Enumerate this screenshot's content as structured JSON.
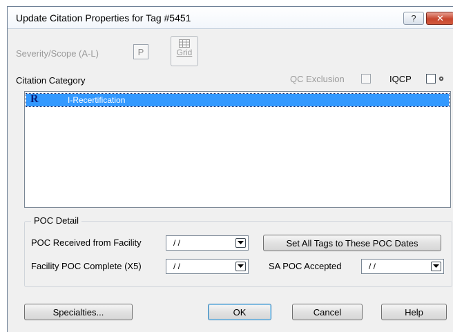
{
  "window": {
    "title": "Update Citation Properties for Tag #5451",
    "help_label": "?",
    "close_label": "✕"
  },
  "severity": {
    "label": "Severity/Scope (A-L)",
    "value": "P"
  },
  "grid_button": {
    "label": "Grid",
    "icon": "grid-icon"
  },
  "citation_category": {
    "label": "Citation Category",
    "items": [
      {
        "icon": "recertification-icon",
        "icon_text": "R",
        "label": "I-Recertification",
        "selected": true
      }
    ]
  },
  "qc_exclusion": {
    "label": "QC Exclusion",
    "checked": false
  },
  "iqcp": {
    "label": "IQCP",
    "checked": false
  },
  "poc_detail": {
    "title": "POC Detail",
    "received_label": "POC Received from Facility",
    "received_value": "/ /",
    "complete_label": "Facility POC Complete (X5)",
    "complete_value": "/ /",
    "set_all_label": "Set All Tags to These POC Dates",
    "sa_accepted_label": "SA POC Accepted",
    "sa_accepted_value": "/ /"
  },
  "footer": {
    "specialties_label": "Specialties...",
    "ok_label": "OK",
    "cancel_label": "Cancel",
    "help_label": "Help"
  },
  "colors": {
    "selection": "#3399ff",
    "window_bg": "#f0f0f0",
    "close_button": "#c7472f"
  }
}
